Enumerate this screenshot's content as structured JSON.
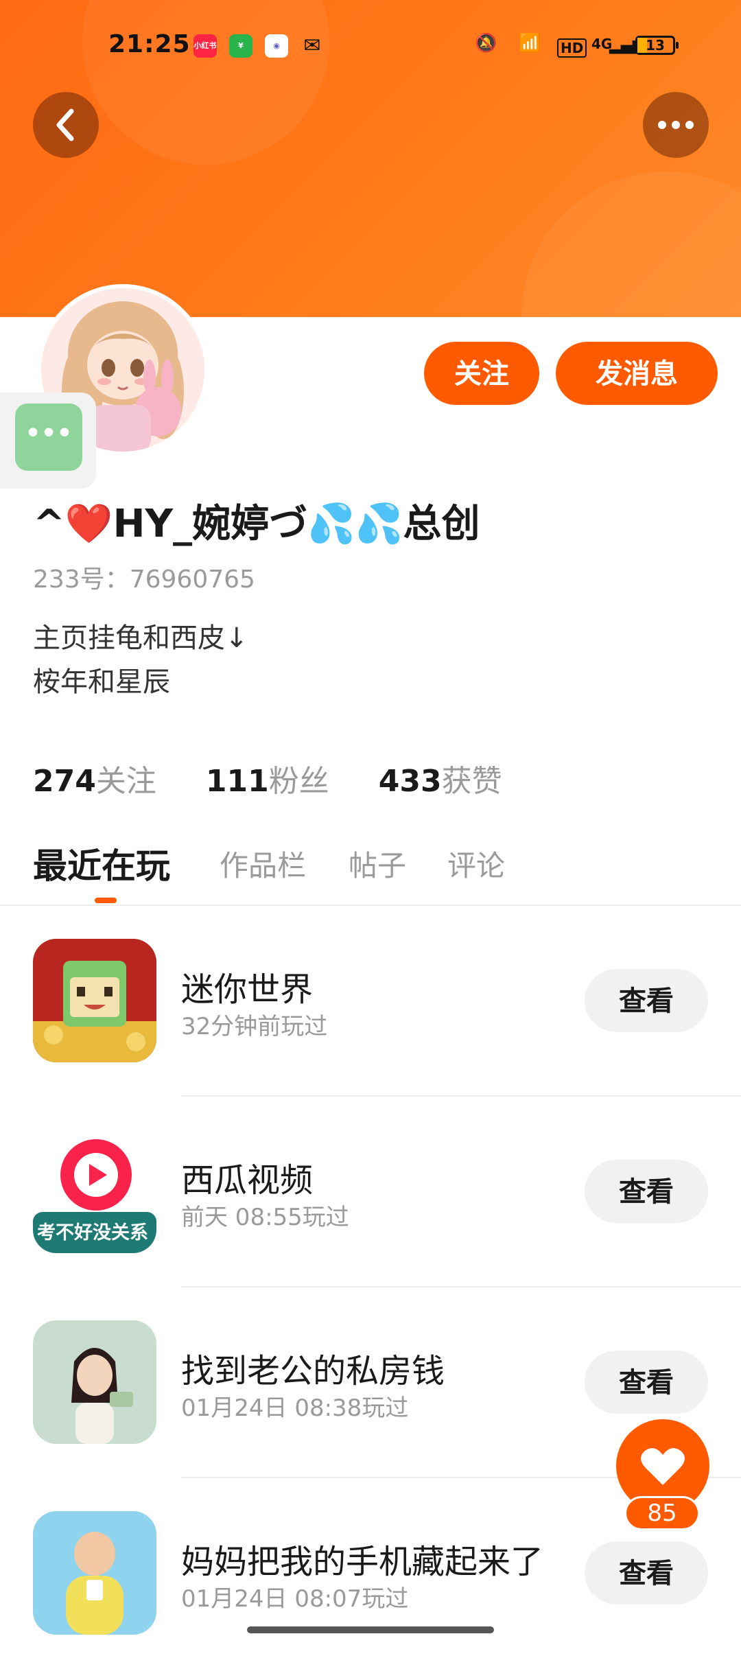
{
  "status_bar": {
    "time": "21:25",
    "apps": [
      "小红书",
      "微信支付",
      "QQ",
      "WeChat"
    ],
    "signal_text": "4G",
    "battery": "13"
  },
  "header": {
    "back_icon": "chevron-left-icon",
    "more_icon": "more-dots-icon"
  },
  "profile": {
    "follow_label": "关注",
    "message_label": "发消息",
    "username": "^❤️HY_婉婷づ💦💦总创",
    "uid": "233号：76960765",
    "bio_line1": "主页挂龟和西皮↓",
    "bio_line2": "桉年和星辰",
    "stats": {
      "following_num": "274",
      "following_label": "关注",
      "fans_num": "111",
      "fans_label": "粉丝",
      "likes_num": "433",
      "likes_label": "获赞"
    }
  },
  "tabs": [
    {
      "label": "最近在玩"
    },
    {
      "label": "作品栏"
    },
    {
      "label": "帖子"
    },
    {
      "label": "评论"
    }
  ],
  "recent": [
    {
      "name": "迷你世界",
      "time": "32分钟前玩过",
      "action": "查看"
    },
    {
      "name": "西瓜视频",
      "time": "前天 08:55玩过",
      "action": "查看"
    },
    {
      "name": "找到老公的私房钱",
      "time": "01月24日 08:38玩过",
      "action": "查看"
    },
    {
      "name": "妈妈把我的手机藏起来了",
      "time": "01月24日 08:07玩过",
      "action": "查看"
    }
  ],
  "xigua_banner": "考不好没关系",
  "like": {
    "count": "85"
  },
  "colors": {
    "accent": "#ff5a00",
    "header": "#ff6a13",
    "muted": "#9a9a9a"
  }
}
